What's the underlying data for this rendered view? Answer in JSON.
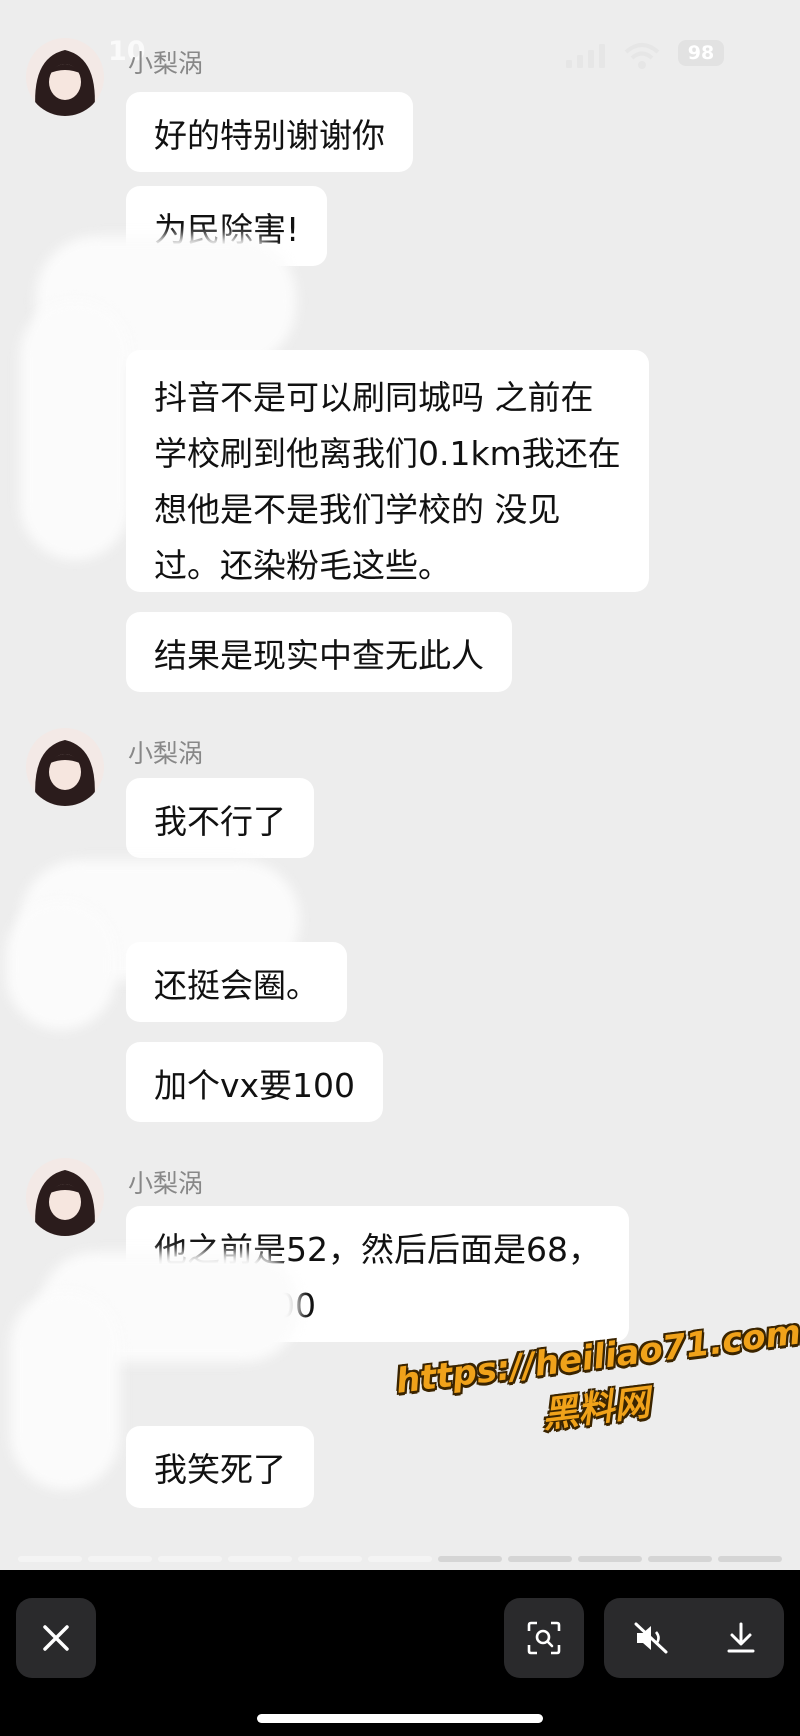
{
  "status": {
    "time": "10",
    "battery": "98"
  },
  "messages": [
    {
      "sender": "小梨涡",
      "bubbles": [
        "好的特别谢谢你",
        "为民除害!"
      ]
    },
    {
      "bubbles": [
        "抖音不是可以刷同城吗 之前在",
        "学校刷到他离我们0.1km我还在",
        "想他是不是我们学校的 没见",
        "过。还染粉毛这些。",
        "结果是现实中查无此人"
      ]
    },
    {
      "sender": "小梨涡",
      "bubbles": [
        "我不行了"
      ]
    },
    {
      "bubbles": [
        "还挺会圈。",
        "加个vx要100"
      ]
    },
    {
      "sender": "小梨涡",
      "bubbles": [
        "他之前是52，然后后面是68，",
        "现在是100"
      ]
    },
    {
      "bubbles": [
        "我笑死了"
      ]
    }
  ],
  "watermark": {
    "url": "https://heiliao71.com",
    "name": "黑料网"
  },
  "story_progress": {
    "segments": 11,
    "completed": 6
  },
  "controls": {
    "close": "close-icon",
    "scan": "scan-icon",
    "mute": "speaker-muted-icon",
    "download": "download-icon"
  }
}
